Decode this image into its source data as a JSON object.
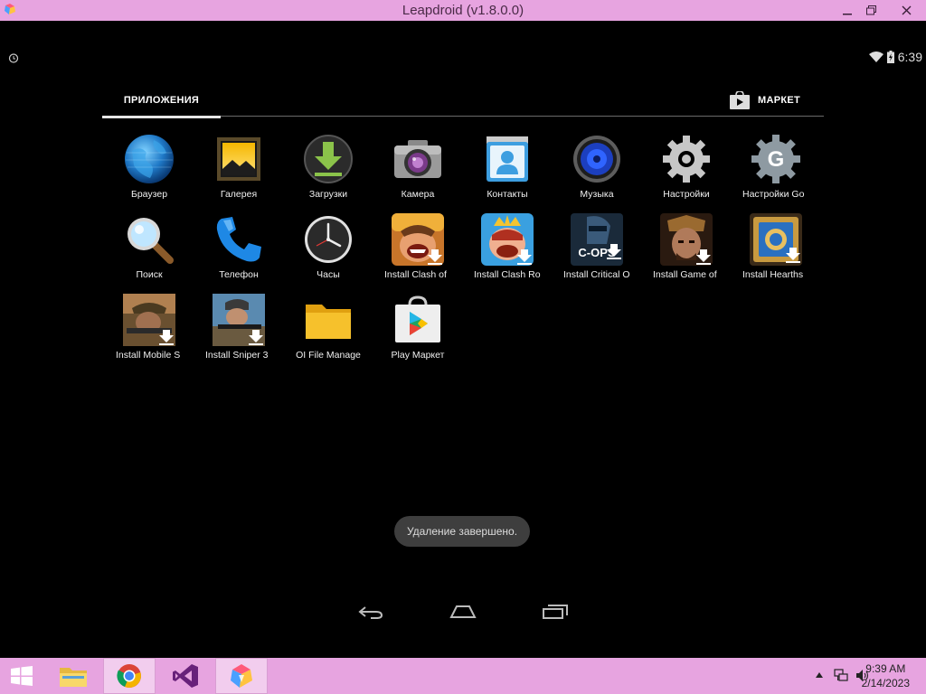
{
  "window": {
    "title": "Leapdroid (v1.8.0.0)"
  },
  "status": {
    "time": "6:39"
  },
  "tabs": {
    "apps": "ПРИЛОЖЕНИЯ",
    "market": "МАРКЕТ"
  },
  "apps": [
    {
      "label": "Браузер",
      "icon": "browser-icon"
    },
    {
      "label": "Галерея",
      "icon": "gallery-icon"
    },
    {
      "label": "Загрузки",
      "icon": "downloads-icon"
    },
    {
      "label": "Камера",
      "icon": "camera-icon"
    },
    {
      "label": "Контакты",
      "icon": "contacts-icon"
    },
    {
      "label": "Музыка",
      "icon": "music-icon"
    },
    {
      "label": "Настройки",
      "icon": "settings-icon"
    },
    {
      "label": "Настройки Go",
      "icon": "google-settings-icon"
    },
    {
      "label": "Поиск",
      "icon": "search-icon"
    },
    {
      "label": "Телефон",
      "icon": "phone-icon"
    },
    {
      "label": "Часы",
      "icon": "clock-icon"
    },
    {
      "label": "Install Clash of",
      "icon": "clash-of-clans-icon"
    },
    {
      "label": "Install Clash Ro",
      "icon": "clash-royale-icon"
    },
    {
      "label": "Install Critical O",
      "icon": "critical-ops-icon"
    },
    {
      "label": "Install Game of",
      "icon": "game-of-war-icon"
    },
    {
      "label": "Install Hearths",
      "icon": "hearthstone-icon"
    },
    {
      "label": "Install Mobile S",
      "icon": "mobile-strike-icon"
    },
    {
      "label": "Install Sniper 3",
      "icon": "sniper-3d-icon"
    },
    {
      "label": "OI File Manage",
      "icon": "folder-icon"
    },
    {
      "label": "Play Маркет",
      "icon": "play-store-icon"
    }
  ],
  "toast": "Удаление завершено.",
  "taskbar": {
    "time": "9:39 AM",
    "date": "2/14/2023"
  },
  "colors": {
    "titlebar": "#e7a4e0",
    "taskbar": "#e7a4e0",
    "screen": "#000000"
  }
}
